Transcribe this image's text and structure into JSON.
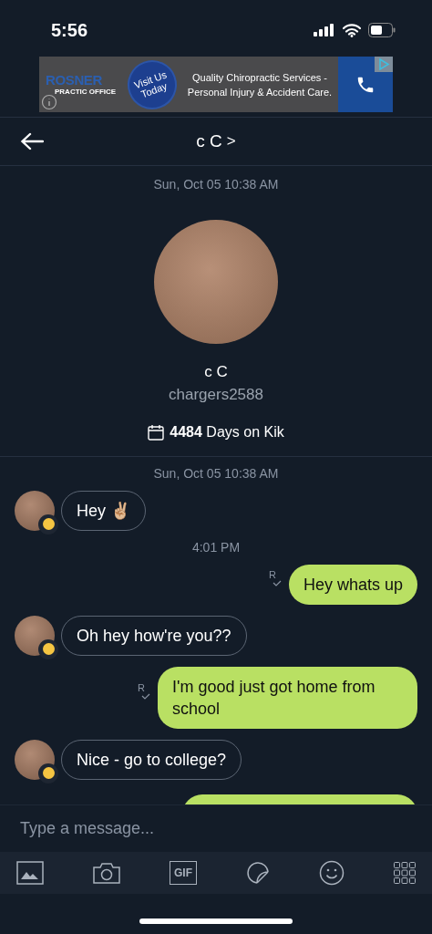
{
  "status_bar": {
    "time": "5:56"
  },
  "ad": {
    "brand": "ROSNER",
    "brand_sub": "PRACTIC OFFICE",
    "badge": "Visit Us Today",
    "text": "Quality Chiropractic Services - Personal Injury & Accident Care."
  },
  "header": {
    "title": "c C",
    "chevron": ">"
  },
  "profile": {
    "date": "Sun, Oct 05 10:38 AM",
    "name": "c C",
    "username": "chargers2588",
    "days": "**4484** Days on Kik"
  },
  "messages": [
    {
      "kind": "date",
      "text": "Sun, Oct 05 10:38 AM"
    },
    {
      "kind": "in",
      "text": "Hey ✌🏼"
    },
    {
      "kind": "date",
      "text": "4:01 PM"
    },
    {
      "kind": "out",
      "text": "Hey whats up",
      "receipt": "R"
    },
    {
      "kind": "in",
      "text": "Oh hey how're you??"
    },
    {
      "kind": "out",
      "text": "I'm good just got home from school",
      "receipt": "R"
    },
    {
      "kind": "in",
      "text": "Nice - go to college?"
    }
  ],
  "composer": {
    "placeholder": "Type a message...",
    "gif": "GIF"
  }
}
